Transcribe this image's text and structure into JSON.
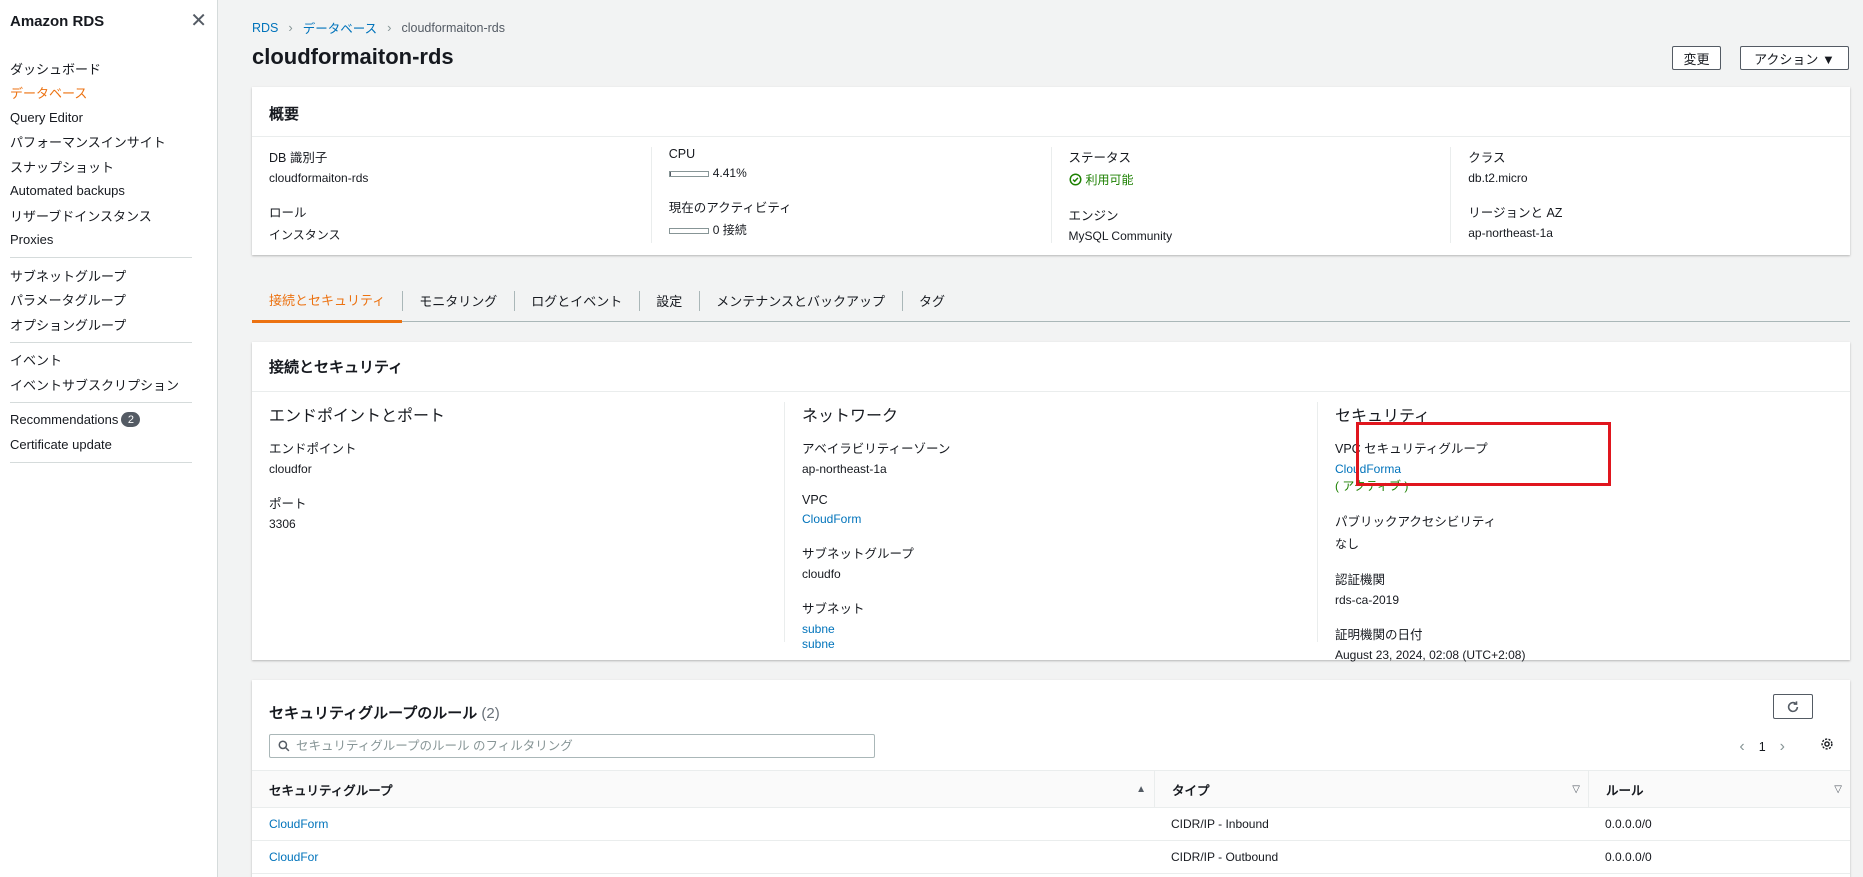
{
  "sidebar": {
    "title": "Amazon RDS",
    "close_icon": "✕",
    "groups": [
      [
        "ダッシュボード",
        "データベース",
        "Query Editor",
        "パフォーマンスインサイト",
        "スナップショット",
        "Automated backups",
        "リザーブドインスタンス",
        "Proxies"
      ],
      [
        "サブネットグループ",
        "パラメータグループ",
        "オプショングループ"
      ],
      [
        "イベント",
        "イベントサブスクリプション"
      ],
      [
        "Recommendations",
        "Certificate update"
      ]
    ],
    "active_item": "データベース",
    "recommendations_badge": "2"
  },
  "breadcrumb": {
    "root": "RDS",
    "level2": "データベース",
    "current": "cloudformaiton-rds"
  },
  "page_title": "cloudformaiton-rds",
  "buttons": {
    "modify": "変更",
    "actions": "アクション ▼"
  },
  "summary": {
    "title": "概要",
    "db_id_label": "DB 識別子",
    "db_id": "cloudformaiton-rds",
    "role_label": "ロール",
    "role": "インスタンス",
    "cpu_label": "CPU",
    "cpu": "4.41%",
    "cpu_fraction": 0.0441,
    "activity_label": "現在のアクティビティ",
    "activity": "0 接続",
    "activity_fraction": 0,
    "status_label": "ステータス",
    "status": "利用可能",
    "engine_label": "エンジン",
    "engine": "MySQL Community",
    "class_label": "クラス",
    "class": "db.t2.micro",
    "region_label": "リージョンと AZ",
    "region": "ap-northeast-1a"
  },
  "tabs": [
    "接続とセキュリティ",
    "モニタリング",
    "ログとイベント",
    "設定",
    "メンテナンスとバックアップ",
    "タグ"
  ],
  "connectivity": {
    "title": "接続とセキュリティ",
    "endpoint_section": "エンドポイントとポート",
    "endpoint_label": "エンドポイント",
    "endpoint": "cloudfor",
    "port_label": "ポート",
    "port": "3306",
    "network_section": "ネットワーク",
    "az_label": "アベイラビリティーゾーン",
    "az": "ap-northeast-1a",
    "vpc_label": "VPC",
    "vpc": "CloudForm",
    "subnet_group_label": "サブネットグループ",
    "subnet_group": "cloudfo",
    "subnet_label": "サブネット",
    "subnet1": "subne",
    "subnet2": "subne",
    "security_section": "セキュリティ",
    "vpc_sg_label": "VPC セキュリティグループ",
    "vpc_sg": "CloudForma",
    "vpc_sg_status": "( アクティブ )",
    "public_label": "パブリックアクセシビリティ",
    "public": "なし",
    "ca_label": "認証機関",
    "ca": "rds-ca-2019",
    "ca_date_label": "証明機関の日付",
    "ca_date": "August 23, 2024, 02:08 (UTC+2:08)"
  },
  "rules": {
    "title": "セキュリティグループのルール",
    "count": "(2)",
    "search_placeholder": "セキュリティグループのルール のフィルタリング",
    "page": "1",
    "columns": [
      "セキュリティグループ",
      "タイプ",
      "ルール"
    ],
    "rows": [
      {
        "group": "CloudForm",
        "type": "CIDR/IP - Inbound",
        "rule": "0.0.0.0/0"
      },
      {
        "group": "CloudFor",
        "type": "CIDR/IP - Outbound",
        "rule": "0.0.0.0/0"
      }
    ]
  },
  "colors": {
    "accent": "#ec7211",
    "link": "#0073bb",
    "success": "#1d8102",
    "highlight": "#e0161e"
  }
}
